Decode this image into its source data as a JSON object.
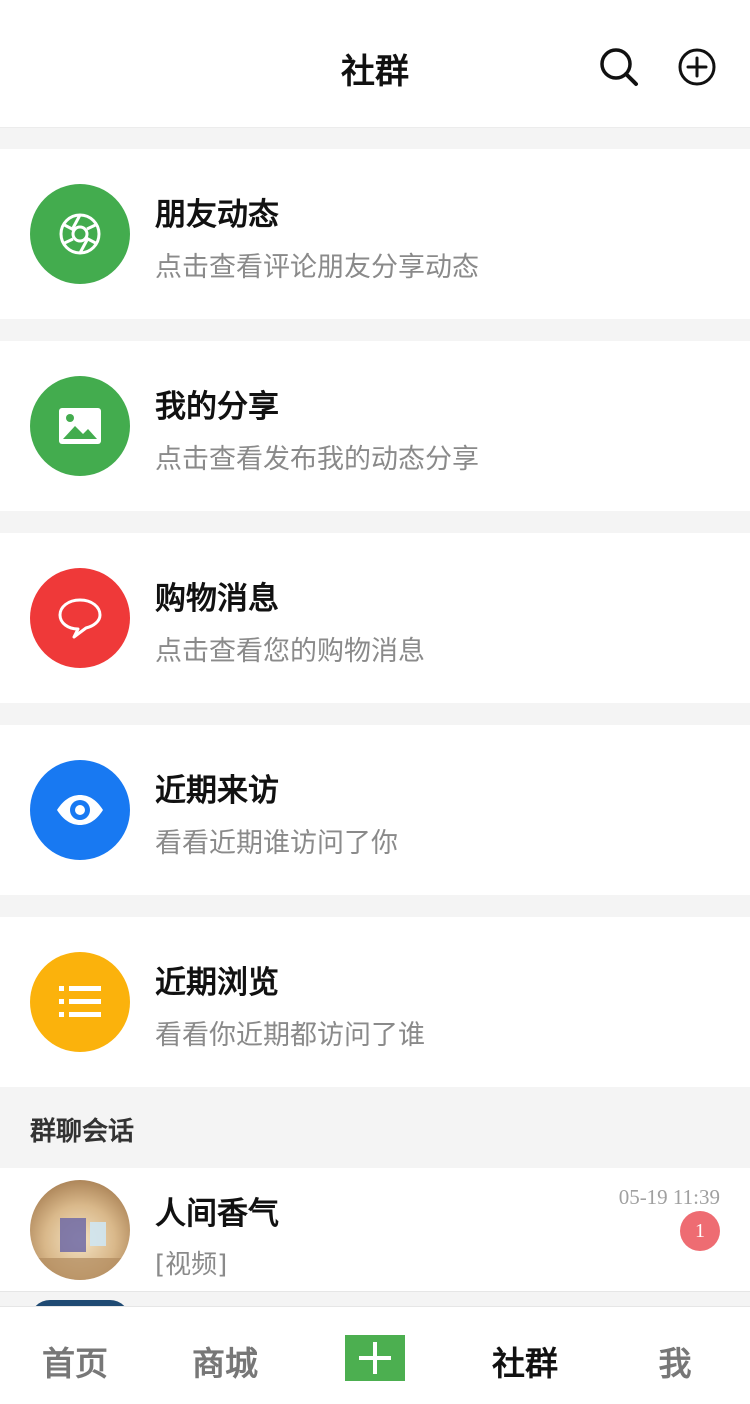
{
  "header": {
    "title": "社群"
  },
  "cards": [
    {
      "title": "朋友动态",
      "subtitle": "点击查看评论朋友分享动态",
      "color": "#43ac4e",
      "icon": "shutter-icon"
    },
    {
      "title": "我的分享",
      "subtitle": "点击查看发布我的动态分享",
      "color": "#43ac4e",
      "icon": "image-icon"
    },
    {
      "title": "购物消息",
      "subtitle": "点击查看您的购物消息",
      "color": "#ef3939",
      "icon": "chat-bubble-icon"
    },
    {
      "title": "近期来访",
      "subtitle": "看看近期谁访问了你",
      "color": "#1879f2",
      "icon": "eye-icon"
    },
    {
      "title": "近期浏览",
      "subtitle": "看看你近期都访问了谁",
      "color": "#fbb20c",
      "icon": "list-icon"
    }
  ],
  "group_chats": {
    "label": "群聊会话",
    "items": [
      {
        "name": "人间香气",
        "preview": "[视频]",
        "time": "05-19 11:39",
        "unread": "1"
      }
    ]
  },
  "tabbar": {
    "home": "首页",
    "mall": "商城",
    "plus_icon": "plus-icon",
    "group": "社群",
    "me": "我",
    "active": "group",
    "accent": "#4caf50"
  }
}
